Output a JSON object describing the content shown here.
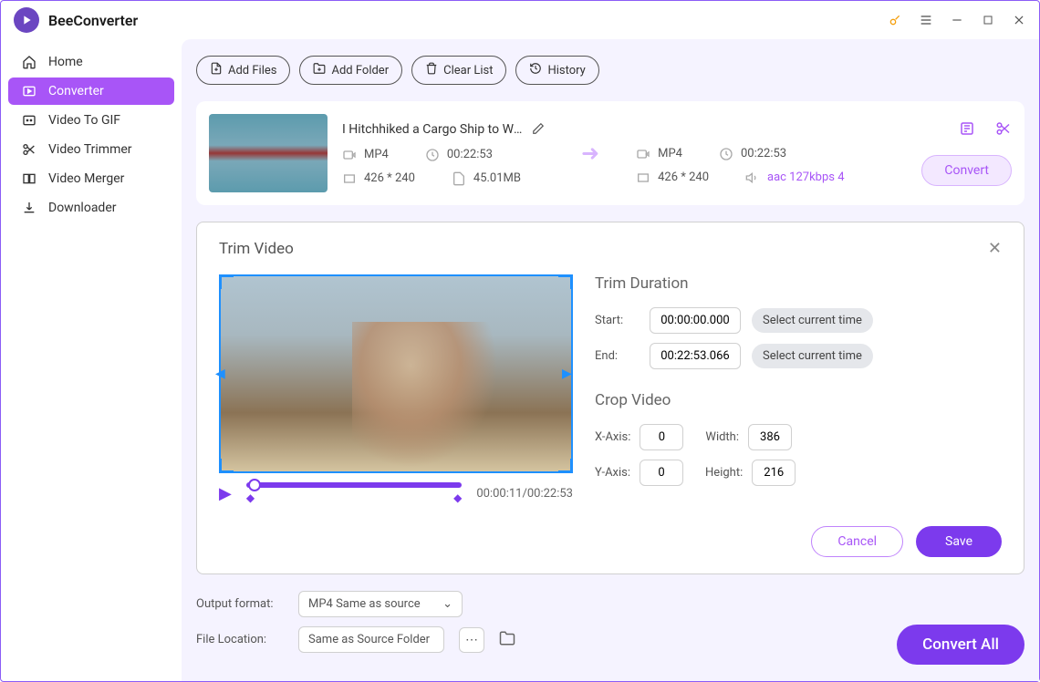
{
  "app": {
    "title": "BeeConverter"
  },
  "sidebar": {
    "items": [
      {
        "label": "Home"
      },
      {
        "label": "Converter"
      },
      {
        "label": "Video To GIF"
      },
      {
        "label": "Video Trimmer"
      },
      {
        "label": "Video Merger"
      },
      {
        "label": "Downloader"
      }
    ]
  },
  "toolbar": {
    "add_files": "Add Files",
    "add_folder": "Add Folder",
    "clear_list": "Clear List",
    "history": "History"
  },
  "file": {
    "title": "I Hitchhiked a Cargo Ship to Wh...",
    "source": {
      "format": "MP4",
      "duration": "00:22:53",
      "resolution": "426 * 240",
      "size": "45.01MB"
    },
    "target": {
      "format": "MP4",
      "duration": "00:22:53",
      "resolution": "426 * 240",
      "audio": "aac 127kbps 4"
    },
    "convert_label": "Convert"
  },
  "modal": {
    "title": "Trim Video",
    "trim": {
      "heading": "Trim Duration",
      "start_label": "Start:",
      "end_label": "End:",
      "start_value": "00:00:00.000",
      "end_value": "00:22:53.066",
      "select_time": "Select current time"
    },
    "crop": {
      "heading": "Crop Video",
      "x_label": "X-Axis:",
      "y_label": "Y-Axis:",
      "w_label": "Width:",
      "h_label": "Height:",
      "x": "0",
      "y": "0",
      "w": "386",
      "h": "216"
    },
    "player_time": "00:00:11/00:22:53",
    "cancel": "Cancel",
    "save": "Save"
  },
  "output": {
    "format_label": "Output format:",
    "format_value": "MP4 Same as source",
    "location_label": "File Location:",
    "location_value": "Same as Source Folder"
  },
  "convert_all": "Convert All"
}
